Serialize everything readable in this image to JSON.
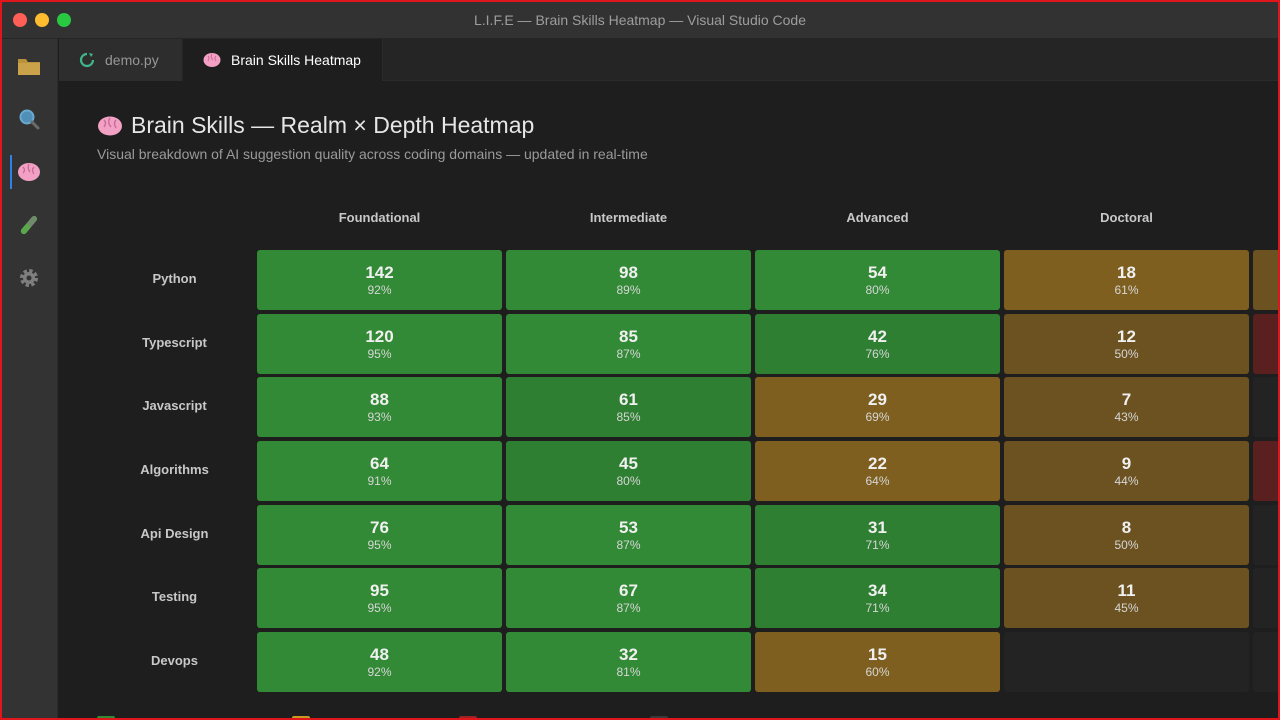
{
  "window": {
    "title": "L.I.F.E — Brain Skills Heatmap — Visual Studio Code"
  },
  "activity_bar": {
    "items": [
      "explorer",
      "search",
      "brain",
      "testing",
      "settings"
    ]
  },
  "tabs": [
    {
      "label": "demo.py",
      "icon": "python-refresh-icon"
    },
    {
      "label": "Brain Skills Heatmap",
      "icon": "brain-icon"
    }
  ],
  "page": {
    "title": "Brain Skills — Realm × Depth Heatmap",
    "subtitle": "Visual breakdown of AI suggestion quality across coding domains — updated in real-time"
  },
  "heatmap": {
    "columns": [
      "Foundational",
      "Intermediate",
      "Advanced",
      "Doctoral"
    ],
    "rows": [
      {
        "label": "Python",
        "cells": [
          {
            "count": "142",
            "pct": "92%",
            "tone": "g1"
          },
          {
            "count": "98",
            "pct": "89%",
            "tone": "g1"
          },
          {
            "count": "54",
            "pct": "80%",
            "tone": "g1"
          },
          {
            "count": "18",
            "pct": "61%",
            "tone": "y1"
          }
        ],
        "edge": "y2"
      },
      {
        "label": "Typescript",
        "cells": [
          {
            "count": "120",
            "pct": "95%",
            "tone": "g1"
          },
          {
            "count": "85",
            "pct": "87%",
            "tone": "g1"
          },
          {
            "count": "42",
            "pct": "76%",
            "tone": "g2"
          },
          {
            "count": "12",
            "pct": "50%",
            "tone": "y2"
          }
        ],
        "edge": "r1"
      },
      {
        "label": "Javascript",
        "cells": [
          {
            "count": "88",
            "pct": "93%",
            "tone": "g1"
          },
          {
            "count": "61",
            "pct": "85%",
            "tone": "g2"
          },
          {
            "count": "29",
            "pct": "69%",
            "tone": "y1"
          },
          {
            "count": "7",
            "pct": "43%",
            "tone": "y2"
          }
        ],
        "edge": "e1"
      },
      {
        "label": "Algorithms",
        "cells": [
          {
            "count": "64",
            "pct": "91%",
            "tone": "g1"
          },
          {
            "count": "45",
            "pct": "80%",
            "tone": "g2"
          },
          {
            "count": "22",
            "pct": "64%",
            "tone": "y1"
          },
          {
            "count": "9",
            "pct": "44%",
            "tone": "y2"
          }
        ],
        "edge": "r1"
      },
      {
        "label": "Api Design",
        "cells": [
          {
            "count": "76",
            "pct": "95%",
            "tone": "g1"
          },
          {
            "count": "53",
            "pct": "87%",
            "tone": "g1"
          },
          {
            "count": "31",
            "pct": "71%",
            "tone": "g2"
          },
          {
            "count": "8",
            "pct": "50%",
            "tone": "y2"
          }
        ],
        "edge": "e1"
      },
      {
        "label": "Testing",
        "cells": [
          {
            "count": "95",
            "pct": "95%",
            "tone": "g1"
          },
          {
            "count": "67",
            "pct": "87%",
            "tone": "g1"
          },
          {
            "count": "34",
            "pct": "71%",
            "tone": "g2"
          },
          {
            "count": "11",
            "pct": "45%",
            "tone": "y2"
          }
        ],
        "edge": "e1"
      },
      {
        "label": "Devops",
        "cells": [
          {
            "count": "48",
            "pct": "92%",
            "tone": "g1"
          },
          {
            "count": "32",
            "pct": "81%",
            "tone": "g1"
          },
          {
            "count": "15",
            "pct": "60%",
            "tone": "y1"
          },
          {
            "count": "",
            "pct": "",
            "tone": "e1"
          }
        ],
        "edge": "e1"
      }
    ]
  },
  "legend": {
    "swatch_colors": [
      "#338a36",
      "#c79a20",
      "#9a2424",
      "#3a3a3a"
    ]
  },
  "colors": {
    "high": "#338a36",
    "mid": "#7e5f20",
    "low": "#5a1f1f",
    "accent": "#2f80ed",
    "window_border": "#e0161c"
  }
}
